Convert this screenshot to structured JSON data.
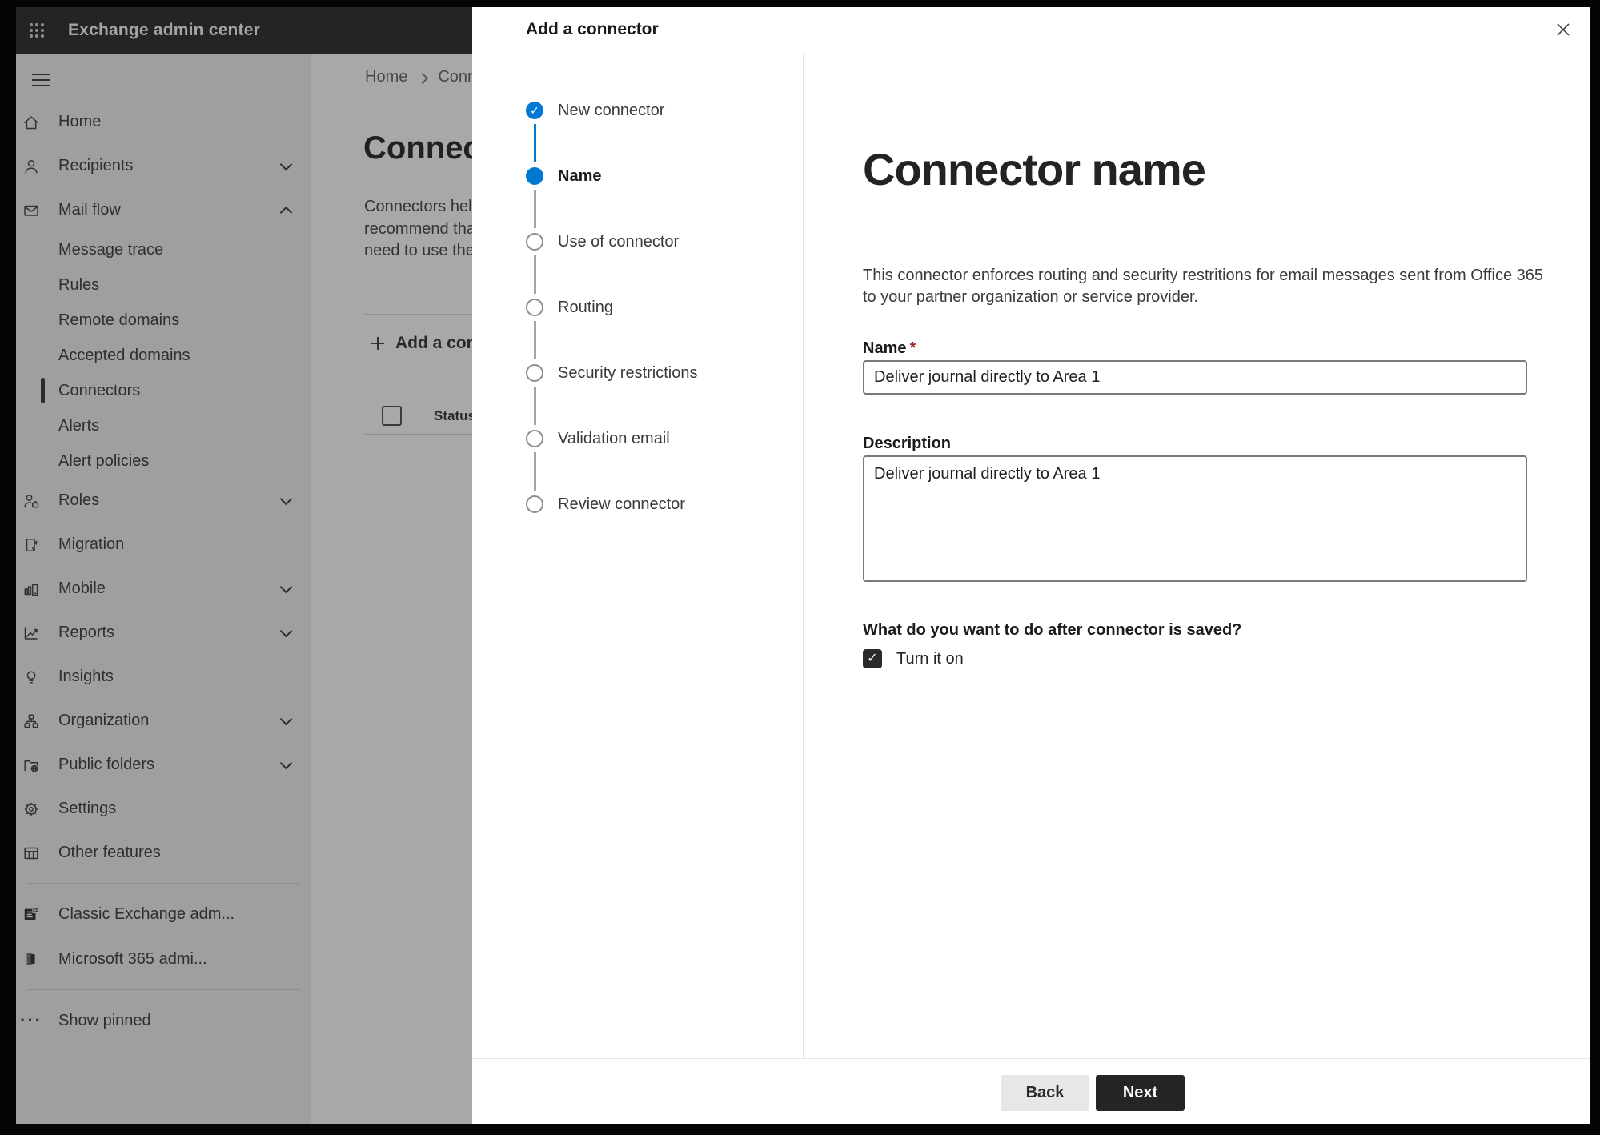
{
  "app_header": {
    "title": "Exchange admin center"
  },
  "sidebar": {
    "items": [
      {
        "label": "Home",
        "icon": "home-icon"
      },
      {
        "label": "Recipients",
        "icon": "person-icon",
        "chevron": "down"
      },
      {
        "label": "Mail flow",
        "icon": "mail-icon",
        "chevron": "up",
        "expanded": true
      },
      {
        "label": "Message trace",
        "sub": true
      },
      {
        "label": "Rules",
        "sub": true
      },
      {
        "label": "Remote domains",
        "sub": true
      },
      {
        "label": "Accepted domains",
        "sub": true
      },
      {
        "label": "Connectors",
        "sub": true,
        "selected": true
      },
      {
        "label": "Alerts",
        "sub": true
      },
      {
        "label": "Alert policies",
        "sub": true
      },
      {
        "label": "Roles",
        "icon": "roles-icon",
        "chevron": "down"
      },
      {
        "label": "Migration",
        "icon": "migration-icon"
      },
      {
        "label": "Mobile",
        "icon": "mobile-icon",
        "chevron": "down"
      },
      {
        "label": "Reports",
        "icon": "reports-icon",
        "chevron": "down"
      },
      {
        "label": "Insights",
        "icon": "lightbulb-icon"
      },
      {
        "label": "Organization",
        "icon": "org-chart-icon",
        "chevron": "down"
      },
      {
        "label": "Public folders",
        "icon": "folder-globe-icon",
        "chevron": "down"
      },
      {
        "label": "Settings",
        "icon": "gear-icon"
      },
      {
        "label": "Other features",
        "icon": "table-icon"
      }
    ],
    "footer_items": [
      {
        "label": "Classic Exchange adm...",
        "icon": "classic-exchange-icon"
      },
      {
        "label": "Microsoft 365 admi...",
        "icon": "microsoft-365-icon"
      }
    ],
    "show_pinned": "Show pinned"
  },
  "page": {
    "breadcrumb": {
      "home": "Home",
      "current": "Conne"
    },
    "heading": "Connec",
    "intro_lines": {
      "line1": "Connectors help",
      "line2": "recommend that",
      "line3": "need to use ther"
    },
    "add_button": "Add a conn",
    "table": {
      "status_header": "Status"
    }
  },
  "dialog": {
    "title": "Add a connector",
    "steps": [
      {
        "label": "New connector",
        "state": "completed"
      },
      {
        "label": "Name",
        "state": "current"
      },
      {
        "label": "Use of connector",
        "state": "upcoming"
      },
      {
        "label": "Routing",
        "state": "upcoming"
      },
      {
        "label": "Security restrictions",
        "state": "upcoming"
      },
      {
        "label": "Validation email",
        "state": "upcoming"
      },
      {
        "label": "Review connector",
        "state": "upcoming"
      }
    ],
    "content": {
      "heading": "Connector name",
      "description": "This connector enforces routing and security restritions for email messages sent from Office 365 to your partner organization or service provider.",
      "name_label": "Name",
      "required_marker": "*",
      "name_value": "Deliver journal directly to Area 1",
      "description_label": "Description",
      "description_value": "Deliver journal directly to Area 1",
      "question": "What do you want to do after connector is saved?",
      "checkbox_label": "Turn it on",
      "checkbox_checked": true,
      "check_glyph": "✓"
    },
    "footer": {
      "back": "Back",
      "next": "Next"
    }
  },
  "colors": {
    "accent": "#0078d4",
    "required": "#a4262c",
    "header_bg": "#3a3735",
    "overlay": "rgba(0,0,0,0.34)"
  }
}
